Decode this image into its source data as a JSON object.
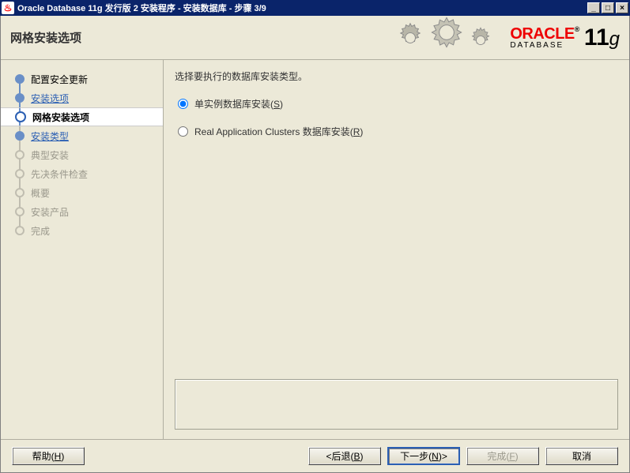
{
  "window": {
    "title": "Oracle Database 11g 发行版 2 安装程序 - 安装数据库 - 步骤 3/9"
  },
  "header": {
    "title": "网格安装选项",
    "logo_main": "ORACLE",
    "logo_sub": "DATABASE",
    "version_num": "11",
    "version_suffix": "g"
  },
  "sidebar": {
    "items": [
      {
        "label": "配置安全更新",
        "state": "done"
      },
      {
        "label": "安装选项",
        "state": "done"
      },
      {
        "label": "网格安装选项",
        "state": "current"
      },
      {
        "label": "安装类型",
        "state": "done"
      },
      {
        "label": "典型安装",
        "state": "future"
      },
      {
        "label": "先决条件检查",
        "state": "future"
      },
      {
        "label": "概要",
        "state": "future"
      },
      {
        "label": "安装产品",
        "state": "future"
      },
      {
        "label": "完成",
        "state": "future"
      }
    ]
  },
  "main": {
    "prompt": "选择要执行的数据库安装类型。",
    "options": [
      {
        "label": "单实例数据库安装(",
        "mnemonic": "S",
        "suffix": ")",
        "checked": true
      },
      {
        "label": "Real Application Clusters 数据库安装(",
        "mnemonic": "R",
        "suffix": ")",
        "checked": false
      }
    ]
  },
  "footer": {
    "help": "帮助(",
    "help_m": "H",
    "back": "后退(",
    "back_m": "B",
    "next": "下一步(",
    "next_m": "N",
    "finish": "完成(",
    "finish_m": "F",
    "cancel": "取消",
    "close_paren": ")"
  }
}
